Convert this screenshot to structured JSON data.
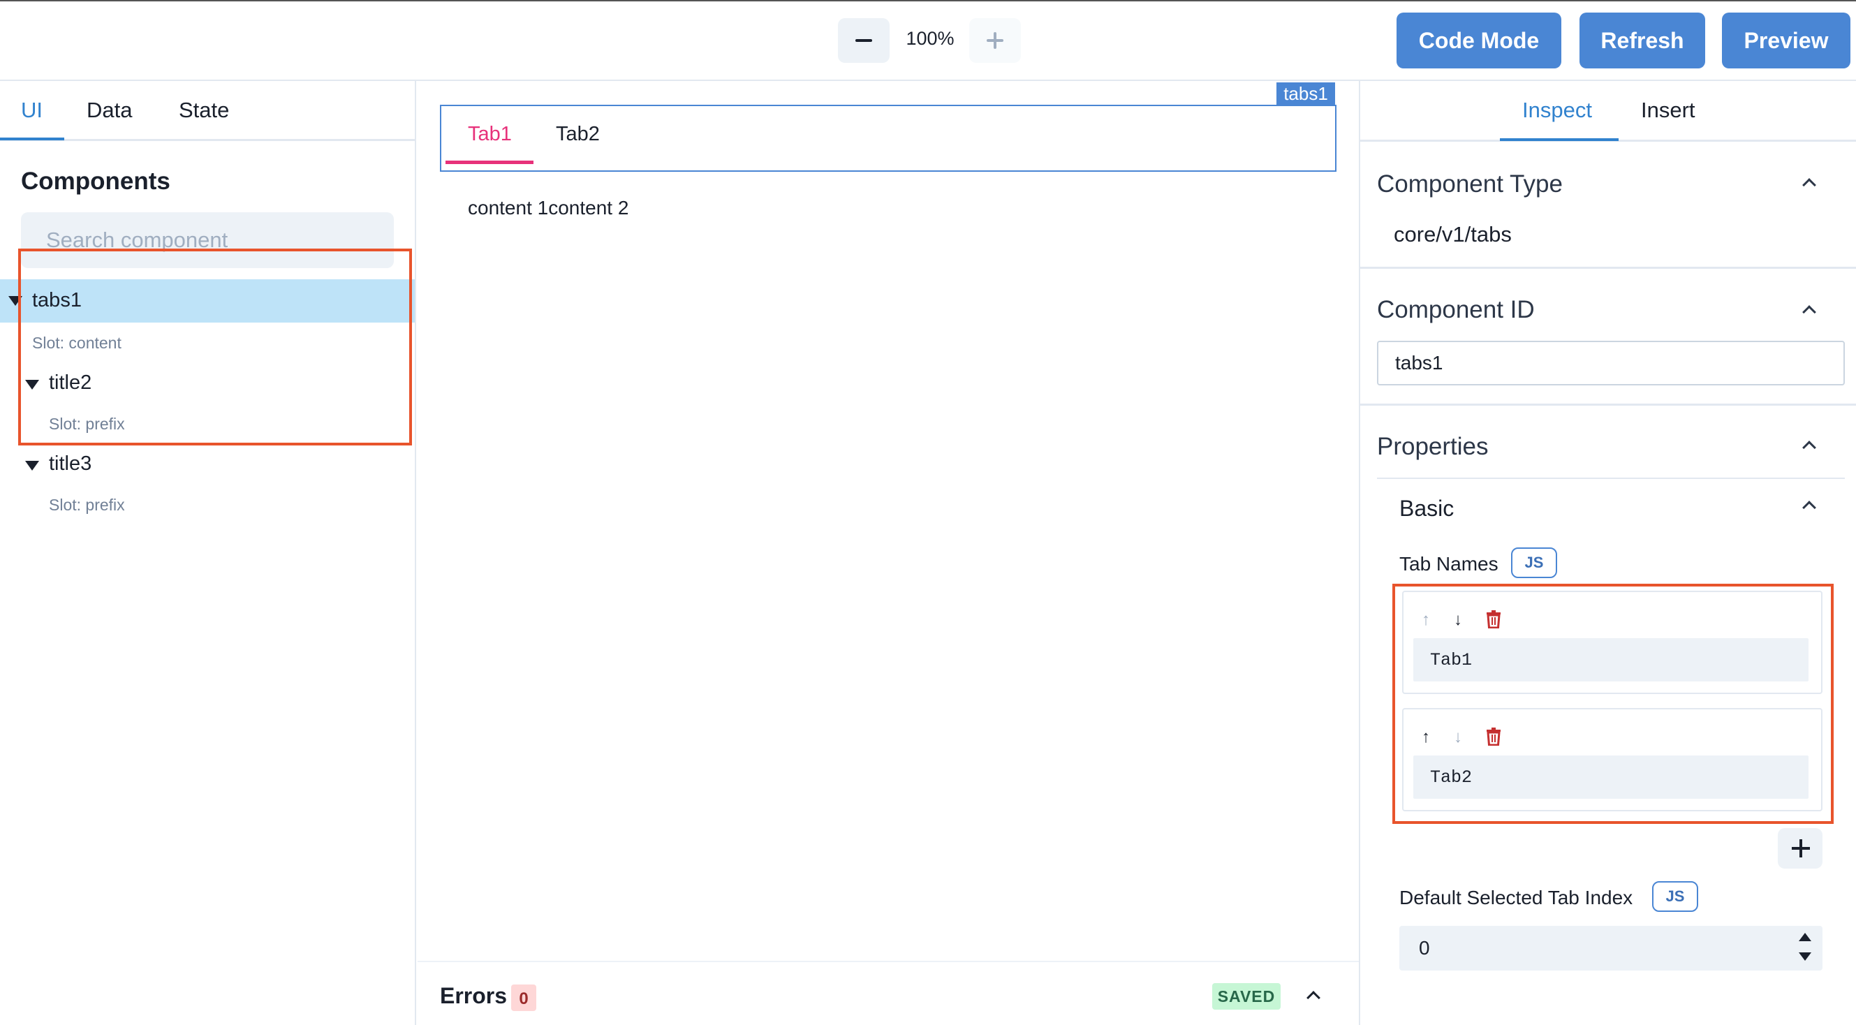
{
  "toolbar": {
    "zoom_level": "100%",
    "code_mode_label": "Code Mode",
    "refresh_label": "Refresh",
    "preview_label": "Preview"
  },
  "left_panel": {
    "tabs": [
      {
        "label": "UI",
        "active": true
      },
      {
        "label": "Data",
        "active": false
      },
      {
        "label": "State",
        "active": false
      }
    ],
    "components_title": "Components",
    "search_placeholder": "Search component",
    "tree": {
      "root": "tabs1",
      "root_slot": "Slot: content",
      "children": [
        {
          "label": "title2",
          "slot": "Slot: prefix"
        },
        {
          "label": "title3",
          "slot": "Slot: prefix"
        }
      ]
    }
  },
  "canvas": {
    "component_tag": "tabs1",
    "tabs": [
      {
        "label": "Tab1",
        "active": true
      },
      {
        "label": "Tab2",
        "active": false
      }
    ],
    "content": "content 1content 2",
    "errors_label": "Errors",
    "errors_count": "0",
    "saved_label": "SAVED"
  },
  "right_panel": {
    "tabs": [
      {
        "label": "Inspect",
        "active": true
      },
      {
        "label": "Insert",
        "active": false
      }
    ],
    "component_type_title": "Component Type",
    "component_type_value": "core/v1/tabs",
    "component_id_title": "Component ID",
    "component_id_value": "tabs1",
    "properties_title": "Properties",
    "basic_title": "Basic",
    "tab_names_label": "Tab Names",
    "js_badge": "JS",
    "tab_names": [
      "Tab1",
      "Tab2"
    ],
    "default_index_label": "Default Selected Tab Index",
    "default_index_value": "0"
  },
  "colors": {
    "accent_blue": "#4a86d4",
    "active_tab_pink": "#e7317a",
    "annotation_red": "#e8542c",
    "selected_row": "#bee3f8"
  }
}
